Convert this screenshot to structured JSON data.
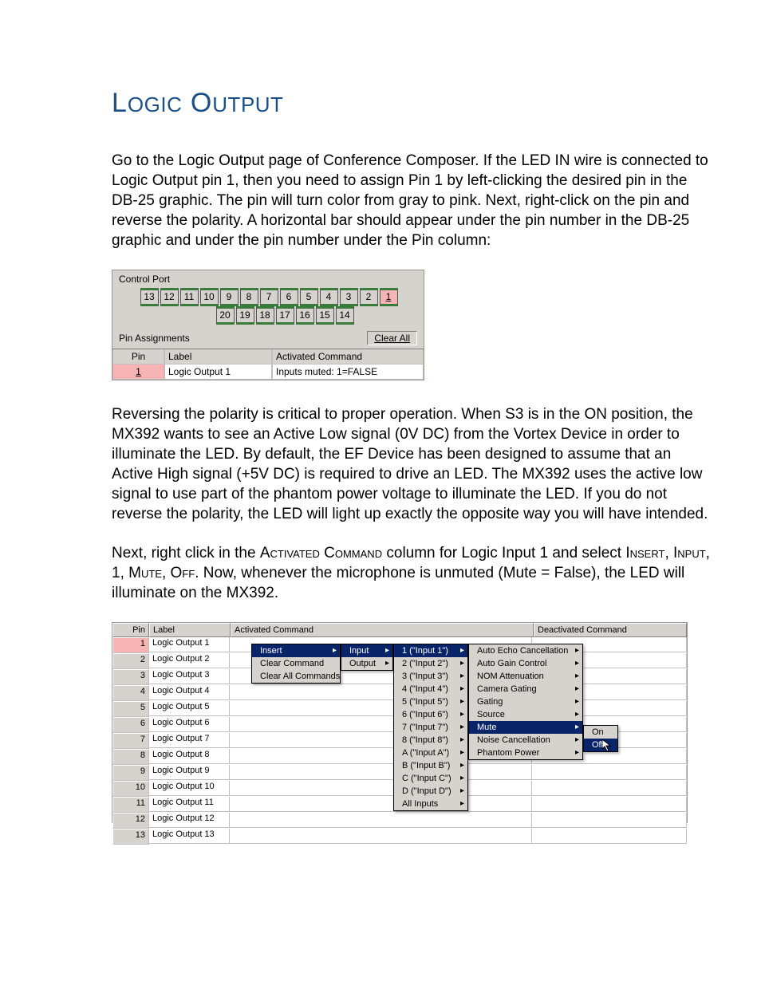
{
  "title": {
    "word1_first": "L",
    "word1_rest": "OGIC",
    "word2_first": "O",
    "word2_rest": "UTPUT"
  },
  "para1": "Go to the Logic Output page of Conference Composer.  If the LED IN wire is connected to Logic Output pin 1, then you need to assign Pin 1 by left-clicking the desired pin in the DB-25 graphic. The pin will turn color from gray to pink. Next, right-click on the pin and reverse the polarity.  A horizontal bar should appear under the pin number in the DB-25 graphic and under the pin number under the Pin column:",
  "ctrlport": {
    "title": "Control Port",
    "top_pins": [
      "13",
      "12",
      "11",
      "10",
      "9",
      "8",
      "7",
      "6",
      "5",
      "4",
      "3",
      "2",
      "1"
    ],
    "bottom_pins": [
      "20",
      "19",
      "18",
      "17",
      "16",
      "15",
      "14"
    ],
    "selected_pin": "1",
    "pin_assignments_label": "Pin Assignments",
    "clear_all": "Clear All",
    "cols": {
      "pin": "Pin",
      "label": "Label",
      "cmd": "Activated Command"
    },
    "row": {
      "pin": "1",
      "label": "Logic Output 1",
      "cmd": "Inputs muted: 1=FALSE"
    }
  },
  "para2": "Reversing the polarity is critical to proper operation.  When S3 is in the ON position, the MX392 wants to see an Active Low signal (0V DC) from the Vortex Device in order to illuminate the LED.  By default, the EF Device has been designed to assume that an Active High signal (+5V DC) is required to drive an LED.  The MX392 uses the active low signal to use part of the phantom power voltage to illuminate the LED.  If you do not reverse the polarity, the LED will light up exactly the opposite way you will have intended.",
  "para3a": "Next, right click in the ",
  "para3_ac": "Activated Command",
  "para3b": " column for Logic Input 1 and select ",
  "para3_ins": "Insert",
  "para3_c1": ", ",
  "para3_inp": "Input",
  "para3_c2": ", 1, ",
  "para3_mute": "Mute",
  "para3_c3": ", ",
  "para3_off": "Off",
  "para3c": ".  Now, whenever the microphone is unmuted (Mute = False), the LED will illuminate on the MX392.",
  "table2": {
    "head": {
      "pin": "Pin",
      "label": "Label",
      "act": "Activated Command",
      "deact": "Deactivated Command"
    },
    "rows": [
      {
        "pin": "1",
        "label": "Logic Output 1"
      },
      {
        "pin": "2",
        "label": "Logic Output 2"
      },
      {
        "pin": "3",
        "label": "Logic Output 3"
      },
      {
        "pin": "4",
        "label": "Logic Output 4"
      },
      {
        "pin": "5",
        "label": "Logic Output 5"
      },
      {
        "pin": "6",
        "label": "Logic Output 6"
      },
      {
        "pin": "7",
        "label": "Logic Output 7"
      },
      {
        "pin": "8",
        "label": "Logic Output 8"
      },
      {
        "pin": "9",
        "label": "Logic Output 9"
      },
      {
        "pin": "10",
        "label": "Logic Output 10"
      },
      {
        "pin": "11",
        "label": "Logic Output 11"
      },
      {
        "pin": "12",
        "label": "Logic Output 12"
      },
      {
        "pin": "13",
        "label": "Logic Output 13"
      }
    ]
  },
  "menus": {
    "m1": [
      {
        "t": "Insert",
        "hl": true,
        "arrow": true
      },
      {
        "t": "Clear Command"
      },
      {
        "t": "Clear All Commands"
      }
    ],
    "m2": [
      {
        "t": "Input",
        "hl": true,
        "arrow": true
      },
      {
        "t": "Output",
        "arrow": true
      }
    ],
    "m3": [
      {
        "t": "1 (\"Input 1\")",
        "hl": true,
        "arrow": true
      },
      {
        "t": "2 (\"Input 2\")",
        "arrow": true
      },
      {
        "t": "3 (\"Input 3\")",
        "arrow": true
      },
      {
        "t": "4 (\"Input 4\")",
        "arrow": true
      },
      {
        "t": "5 (\"Input 5\")",
        "arrow": true
      },
      {
        "t": "6 (\"Input 6\")",
        "arrow": true
      },
      {
        "t": "7 (\"Input 7\")",
        "arrow": true
      },
      {
        "t": "8 (\"Input 8\")",
        "arrow": true
      },
      {
        "t": "A (\"Input A\")",
        "arrow": true
      },
      {
        "t": "B (\"Input B\")",
        "arrow": true
      },
      {
        "t": "C (\"Input C\")",
        "arrow": true
      },
      {
        "t": "D (\"Input D\")",
        "arrow": true
      },
      {
        "t": "All Inputs",
        "arrow": true
      }
    ],
    "m4": [
      {
        "t": "Auto Echo Cancellation",
        "arrow": true
      },
      {
        "t": "Auto Gain Control",
        "arrow": true
      },
      {
        "t": "NOM Attenuation",
        "arrow": true
      },
      {
        "t": "Camera Gating",
        "arrow": true
      },
      {
        "t": "Gating",
        "arrow": true
      },
      {
        "t": "Source",
        "arrow": true
      },
      {
        "t": "Mute",
        "hl": true,
        "arrow": true
      },
      {
        "t": "Noise Cancellation",
        "arrow": true
      },
      {
        "t": "Phantom Power",
        "arrow": true
      }
    ],
    "m5": [
      {
        "t": "On"
      },
      {
        "t": "Off",
        "hl": true
      }
    ]
  }
}
